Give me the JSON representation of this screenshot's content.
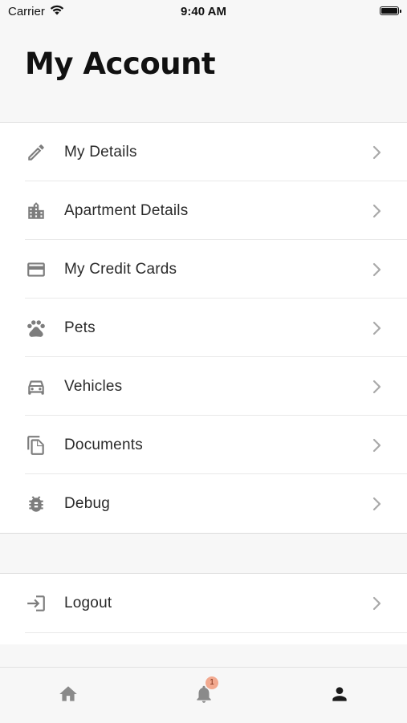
{
  "status_bar": {
    "carrier": "Carrier",
    "time": "9:40 AM"
  },
  "header": {
    "title": "My Account"
  },
  "menu": {
    "items": [
      {
        "label": "My Details",
        "icon": "pencil-icon"
      },
      {
        "label": "Apartment Details",
        "icon": "building-icon"
      },
      {
        "label": "My Credit Cards",
        "icon": "credit-card-icon"
      },
      {
        "label": "Pets",
        "icon": "paw-icon"
      },
      {
        "label": "Vehicles",
        "icon": "car-icon"
      },
      {
        "label": "Documents",
        "icon": "documents-icon"
      },
      {
        "label": "Debug",
        "icon": "bug-icon"
      }
    ]
  },
  "logout": {
    "label": "Logout",
    "icon": "login-arrow-icon"
  },
  "tab_bar": {
    "tabs": [
      {
        "name": "home",
        "icon": "home-icon",
        "active": false
      },
      {
        "name": "notifications",
        "icon": "bell-icon",
        "active": false,
        "badge": "1"
      },
      {
        "name": "account",
        "icon": "person-icon",
        "active": true
      }
    ]
  },
  "colors": {
    "icon_gray": "#7d7d7d",
    "chevron_gray": "#a9a9a9",
    "active_tab": "#1a1a1a",
    "inactive_tab": "#8a8a8a",
    "badge_bg": "#f2a98f"
  }
}
